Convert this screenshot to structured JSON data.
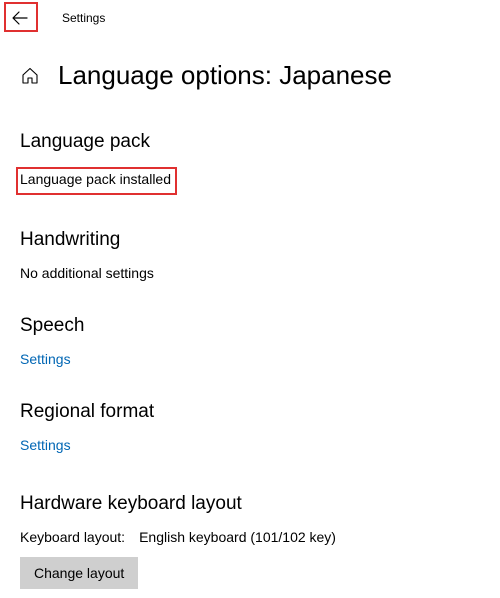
{
  "topbar": {
    "title": "Settings"
  },
  "page": {
    "title": "Language options: Japanese"
  },
  "sections": {
    "language_pack": {
      "heading": "Language pack",
      "status": "Language pack installed"
    },
    "handwriting": {
      "heading": "Handwriting",
      "status": "No additional settings"
    },
    "speech": {
      "heading": "Speech",
      "link": "Settings"
    },
    "regional_format": {
      "heading": "Regional format",
      "link": "Settings"
    },
    "hardware_keyboard": {
      "heading": "Hardware keyboard layout",
      "label": "Keyboard layout:",
      "value": "English keyboard (101/102 key)",
      "button": "Change layout"
    }
  }
}
